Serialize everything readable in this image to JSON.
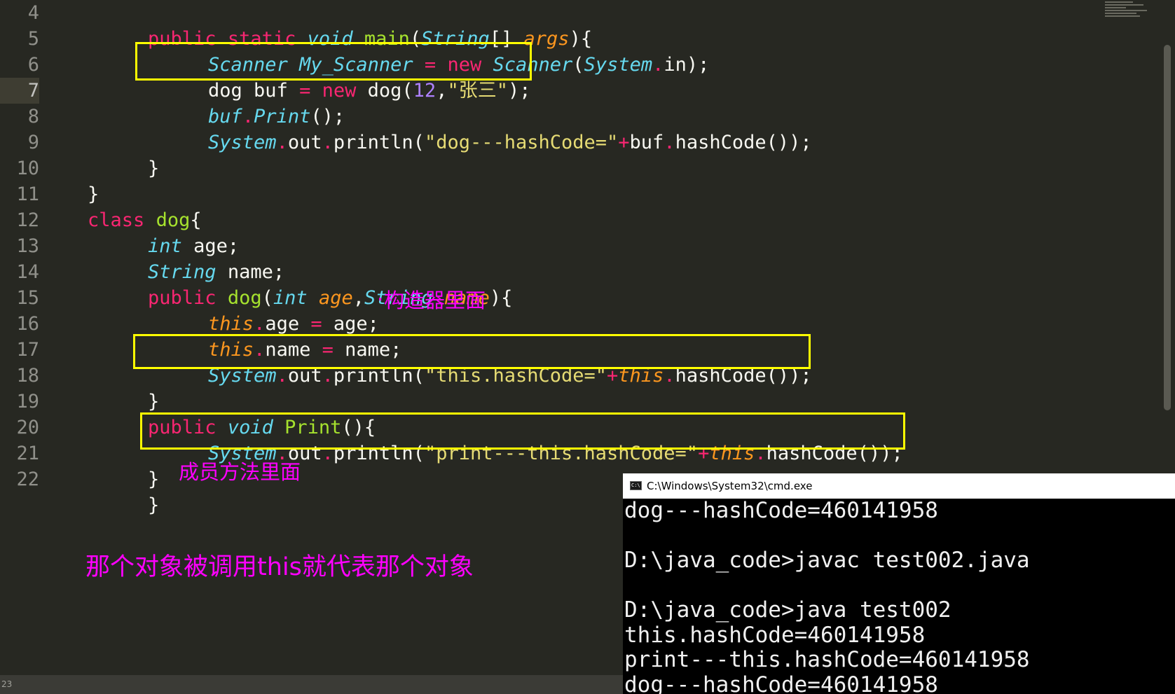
{
  "editor": {
    "gutter": [
      "4",
      "5",
      "6",
      "7",
      "8",
      "9",
      "10",
      "11",
      "12",
      "13",
      "14",
      "15",
      "16",
      "17",
      "18",
      "19",
      "20",
      "21",
      "22"
    ],
    "active_line": "7",
    "lines": {
      "l4": [
        "public static ",
        "void",
        " ",
        "main",
        "(",
        "String",
        "[] ",
        "args",
        "){"
      ],
      "l5": [
        "Scanner",
        " ",
        "My_Scanner",
        " ",
        "=",
        " ",
        "new",
        " ",
        "Scanner",
        "(",
        "System",
        ".",
        "in",
        ");"
      ],
      "l6": [
        "dog buf ",
        "=",
        " ",
        "new",
        " dog(",
        "12",
        ",",
        "\"张三\"",
        ");"
      ],
      "l7": [
        "buf",
        ".",
        "Print",
        "();"
      ],
      "l8": [
        "System",
        ".",
        "out",
        ".",
        "println(",
        "\"dog---hashCode=\"",
        "+",
        "buf",
        ".",
        "hashCode());"
      ],
      "l9": [
        "}"
      ],
      "l10": [
        "}"
      ],
      "l11": [
        "class",
        " ",
        "dog",
        "{"
      ],
      "l12": [
        "int",
        " age;"
      ],
      "l13": [
        "String",
        " name;"
      ],
      "l14": [
        "public",
        " ",
        "dog",
        "(",
        "int",
        " ",
        "age",
        ",",
        "String",
        " ",
        "name",
        "){"
      ],
      "l15": [
        "this",
        ".",
        "age ",
        "=",
        " age;"
      ],
      "l16": [
        "this",
        ".",
        "name ",
        "=",
        " name;"
      ],
      "l17": [
        "System",
        ".",
        "out",
        ".",
        "println(",
        "\"this.hashCode=\"",
        "+",
        "this",
        ".",
        "hashCode());"
      ],
      "l18": [
        "}"
      ],
      "l19": [
        "public",
        " ",
        "void",
        " ",
        "Print",
        "(){"
      ],
      "l20": [
        "System",
        ".",
        "out",
        ".",
        "println(",
        "\"print---this.hashCode=\"",
        "+",
        "this",
        ".",
        "hashCode());"
      ],
      "l21": [
        "}"
      ],
      "l22": [
        "}"
      ]
    }
  },
  "annotations": {
    "constructor_note": "构造器里面",
    "method_note": "成员方法里面",
    "main_note": "那个对象被调用this就代表那个对象",
    "dot_mark": "."
  },
  "statusbar": {
    "line_text": "23"
  },
  "cmd_window": {
    "title": "C:\\Windows\\System32\\cmd.exe",
    "icon_text": "C:\\",
    "lines": [
      "dog---hashCode=460141958",
      "",
      "D:\\java_code>javac test002.java",
      "",
      "D:\\java_code>java test002",
      "this.hashCode=460141958",
      "print---this.hashCode=460141958",
      "dog---hashCode=460141958"
    ]
  },
  "colors": {
    "background": "#272822",
    "keyword": "#f92672",
    "type": "#66d9ef",
    "function": "#a6e22e",
    "argument": "#fd971f",
    "string": "#e6db74",
    "number": "#ae81ff",
    "highlight_box": "#ffff00",
    "annotation": "#ff00ff"
  }
}
